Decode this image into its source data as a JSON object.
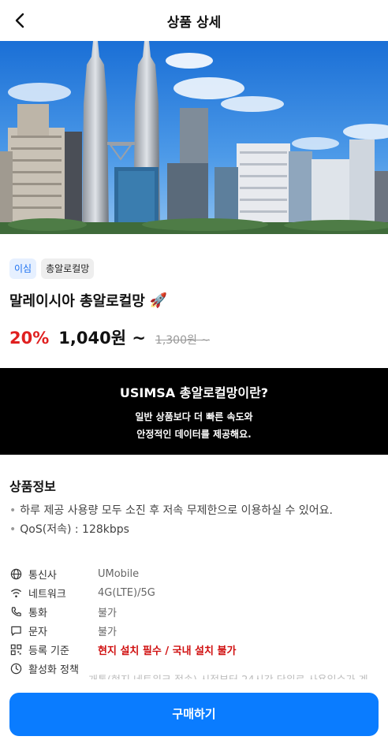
{
  "header": {
    "title": "상품 상세",
    "back_icon": "chevron-left-icon"
  },
  "hero": {
    "alt": "Kuala Lumpur skyline"
  },
  "tags": [
    "이심",
    "총알로컬망"
  ],
  "product": {
    "title": "말레이시아 총알로컬망",
    "title_emoji": "🚀",
    "discount": "20%",
    "price": "1,040원 ~",
    "original_price": "1,300원 ~"
  },
  "banner": {
    "title": "USIMSA 총알로컬망이란?",
    "line1": "일반 상품보다 더 빠른 속도와",
    "line2": "안정적인 데이터를 제공해요."
  },
  "info": {
    "title": "상품정보",
    "bullets": [
      "하루 제공 사용량 모두 소진 후 저속 무제한으로 이용하실 수 있어요.",
      "QoS(저속) : 128kbps"
    ],
    "specs": [
      {
        "icon": "globe-icon",
        "label": "통신사",
        "value": "UMobile"
      },
      {
        "icon": "wifi-icon",
        "label": "네트워크",
        "value": "4G(LTE)/5G"
      },
      {
        "icon": "phone-icon",
        "label": "통화",
        "value": "불가"
      },
      {
        "icon": "message-icon",
        "label": "문자",
        "value": "불가"
      },
      {
        "icon": "qr-icon",
        "label": "등록 기준",
        "value": "현지 설치 필수 / 국내 설치 불가"
      },
      {
        "icon": "clock-icon",
        "label": "활성화 정책",
        "value": ""
      }
    ],
    "activation_overflow": "개통(현지 네트워크 접속) 시점부터 24시간 단위로 사용일수가 계"
  },
  "cta": {
    "buy_label": "구매하기"
  },
  "colors": {
    "accent": "#0a7cff",
    "discount": "#e02020",
    "banner_bg": "#000000"
  }
}
